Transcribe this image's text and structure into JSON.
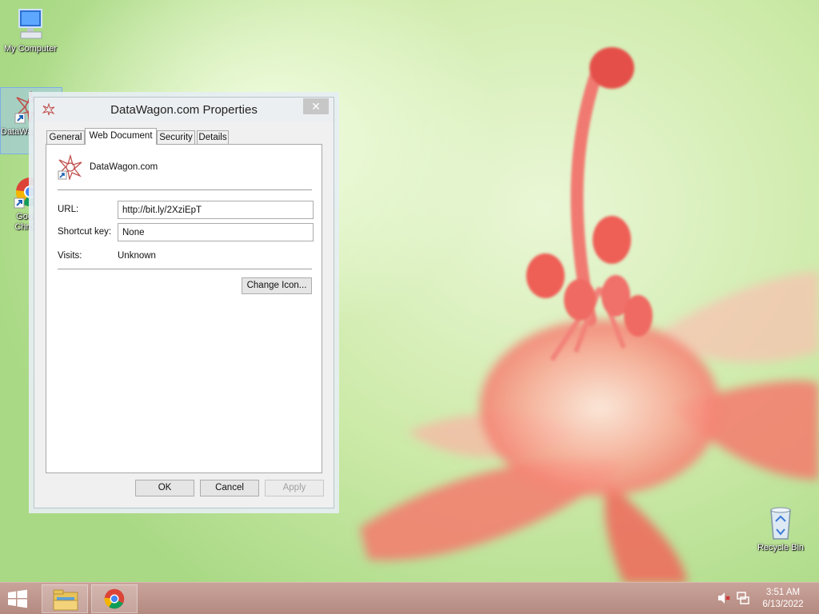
{
  "desktop": {
    "icons": [
      {
        "label": "My Computer"
      },
      {
        "label": "DataWagon.com"
      },
      {
        "label": "Google Chrome"
      },
      {
        "label": "Recycle Bin"
      }
    ]
  },
  "dialog": {
    "title": "DataWagon.com Properties",
    "close_label": "✕",
    "tabs": [
      {
        "label": "General"
      },
      {
        "label": "Web Document"
      },
      {
        "label": "Security"
      },
      {
        "label": "Details"
      }
    ],
    "active_tab": "Web Document",
    "header_name": "DataWagon.com",
    "url": {
      "label": "URL:",
      "value": "http://bit.ly/2XziEpT"
    },
    "shortcut_key": {
      "label": "Shortcut key:",
      "value": "None"
    },
    "visits": {
      "label": "Visits:",
      "value": "Unknown"
    },
    "change_icon_label": "Change Icon...",
    "ok_label": "OK",
    "cancel_label": "Cancel",
    "apply_label": "Apply"
  },
  "taskbar": {
    "time": "3:51 AM",
    "date": "6/13/2022"
  },
  "colors": {
    "accent_selection": "#a0c8f0",
    "taskbar": "#b48a80",
    "flower": "#f26a5e"
  }
}
